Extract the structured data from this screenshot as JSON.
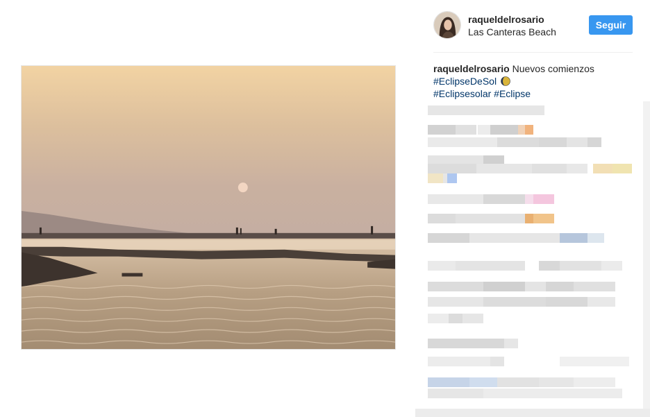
{
  "post": {
    "username": "raqueldelrosario",
    "location": "Las Canteras Beach",
    "follow_label": "Seguir",
    "caption": {
      "user": "raqueldelrosario",
      "text": "Nuevos comienzos",
      "hashtags": [
        "#EclipseDeSol",
        "#Eclipsesolar",
        "#Eclipse"
      ],
      "emoji_icon": "moon-icon"
    },
    "photo_description_icon": "sunset-beach-photo"
  },
  "colors": {
    "follow_button": "#3897f0",
    "hashtag": "#003569",
    "text": "#262626",
    "divider": "#efefef"
  },
  "comments_obscured": true
}
